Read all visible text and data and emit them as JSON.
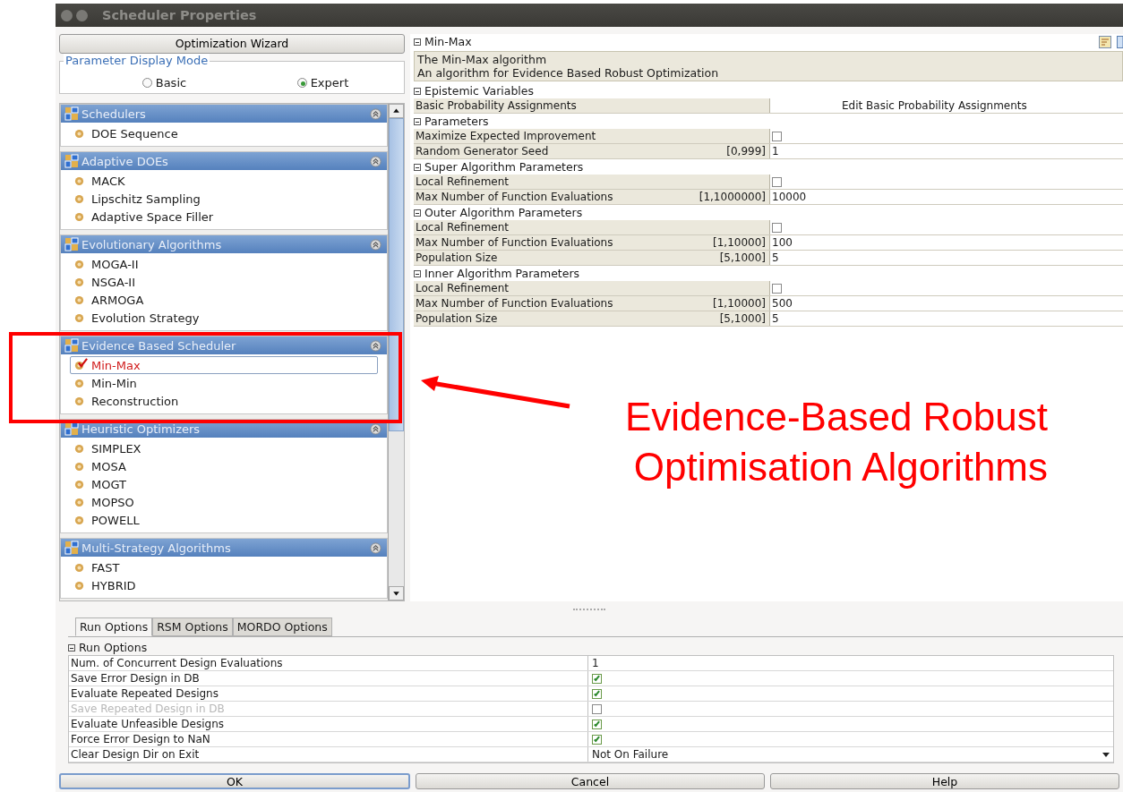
{
  "window": {
    "title": "Scheduler Properties"
  },
  "wizard_button": "Optimization Wizard",
  "display_mode": {
    "label": "Parameter Display Mode",
    "options": [
      {
        "label": "Basic",
        "selected": false
      },
      {
        "label": "Expert",
        "selected": true
      }
    ]
  },
  "scheduler_groups": [
    {
      "title": "Schedulers",
      "items": [
        {
          "label": "DOE Sequence",
          "selected": false
        }
      ]
    },
    {
      "title": "Adaptive DOEs",
      "items": [
        {
          "label": "MACK",
          "selected": false
        },
        {
          "label": "Lipschitz Sampling",
          "selected": false
        },
        {
          "label": "Adaptive Space Filler",
          "selected": false
        }
      ]
    },
    {
      "title": "Evolutionary Algorithms",
      "items": [
        {
          "label": "MOGA-II",
          "selected": false
        },
        {
          "label": "NSGA-II",
          "selected": false
        },
        {
          "label": "ARMOGA",
          "selected": false
        },
        {
          "label": "Evolution Strategy",
          "selected": false
        }
      ]
    },
    {
      "title": "Evidence Based Scheduler",
      "items": [
        {
          "label": "Min-Max",
          "selected": true
        },
        {
          "label": "Min-Min",
          "selected": false
        },
        {
          "label": "Reconstruction",
          "selected": false
        }
      ]
    },
    {
      "title": "Heuristic Optimizers",
      "items": [
        {
          "label": "SIMPLEX",
          "selected": false
        },
        {
          "label": "MOSA",
          "selected": false
        },
        {
          "label": "MOGT",
          "selected": false
        },
        {
          "label": "MOPSO",
          "selected": false
        },
        {
          "label": "POWELL",
          "selected": false
        }
      ]
    },
    {
      "title": "Multi-Strategy Algorithms",
      "items": [
        {
          "label": "FAST",
          "selected": false
        },
        {
          "label": "HYBRID",
          "selected": false
        }
      ]
    }
  ],
  "properties": {
    "title": "Min-Max",
    "description": [
      "The Min-Max algorithm",
      "An algorithm for Evidence Based Robust Optimization"
    ],
    "sections": [
      {
        "title": "Epistemic Variables",
        "rows": [
          {
            "kind": "button",
            "label": "Basic Probability Assignments",
            "value": "Edit Basic Probability Assignments"
          }
        ]
      },
      {
        "title": "Parameters",
        "rows": [
          {
            "kind": "checkbox",
            "label": "Maximize Expected Improvement",
            "checked": false
          },
          {
            "kind": "number",
            "label": "Random Generator Seed",
            "range": "[0,999]",
            "value": "1"
          }
        ]
      },
      {
        "title": "Super Algorithm Parameters",
        "rows": [
          {
            "kind": "checkbox",
            "label": "Local Refinement",
            "checked": false
          },
          {
            "kind": "number",
            "label": "Max Number of Function Evaluations",
            "range": "[1,1000000]",
            "value": "10000"
          }
        ]
      },
      {
        "title": "Outer Algorithm Parameters",
        "rows": [
          {
            "kind": "checkbox",
            "label": "Local Refinement",
            "checked": false
          },
          {
            "kind": "number",
            "label": "Max Number of Function Evaluations",
            "range": "[1,10000]",
            "value": "100"
          },
          {
            "kind": "number",
            "label": "Population Size",
            "range": "[5,1000]",
            "value": "5"
          }
        ]
      },
      {
        "title": "Inner Algorithm Parameters",
        "rows": [
          {
            "kind": "checkbox",
            "label": "Local Refinement",
            "checked": false
          },
          {
            "kind": "number",
            "label": "Max Number of Function Evaluations",
            "range": "[1,10000]",
            "value": "500"
          },
          {
            "kind": "number",
            "label": "Population Size",
            "range": "[5,1000]",
            "value": "5"
          }
        ]
      }
    ]
  },
  "run_tabs": [
    {
      "label": "Run Options",
      "selected": true
    },
    {
      "label": "RSM Options",
      "selected": false
    },
    {
      "label": "MORDO Options",
      "selected": false
    }
  ],
  "run_options": {
    "title": "Run Options",
    "rows": [
      {
        "kind": "number",
        "label": "Num. of Concurrent Design Evaluations",
        "value": "1",
        "disabled": false
      },
      {
        "kind": "checkbox",
        "label": "Save Error Design in DB",
        "checked": true,
        "disabled": false
      },
      {
        "kind": "checkbox",
        "label": "Evaluate Repeated Designs",
        "checked": true,
        "disabled": false
      },
      {
        "kind": "checkbox",
        "label": "Save Repeated Design in DB",
        "checked": false,
        "disabled": true
      },
      {
        "kind": "checkbox",
        "label": "Evaluate Unfeasible Designs",
        "checked": true,
        "disabled": false
      },
      {
        "kind": "checkbox",
        "label": "Force Error Design to NaN",
        "checked": true,
        "disabled": false
      },
      {
        "kind": "dropdown",
        "label": "Clear Design Dir on Exit",
        "value": "Not On Failure",
        "disabled": false
      }
    ]
  },
  "buttons": [
    "OK",
    "Cancel",
    "Help"
  ],
  "annotation": {
    "text": "Evidence-Based Robust\nOptimisation Algorithms"
  }
}
